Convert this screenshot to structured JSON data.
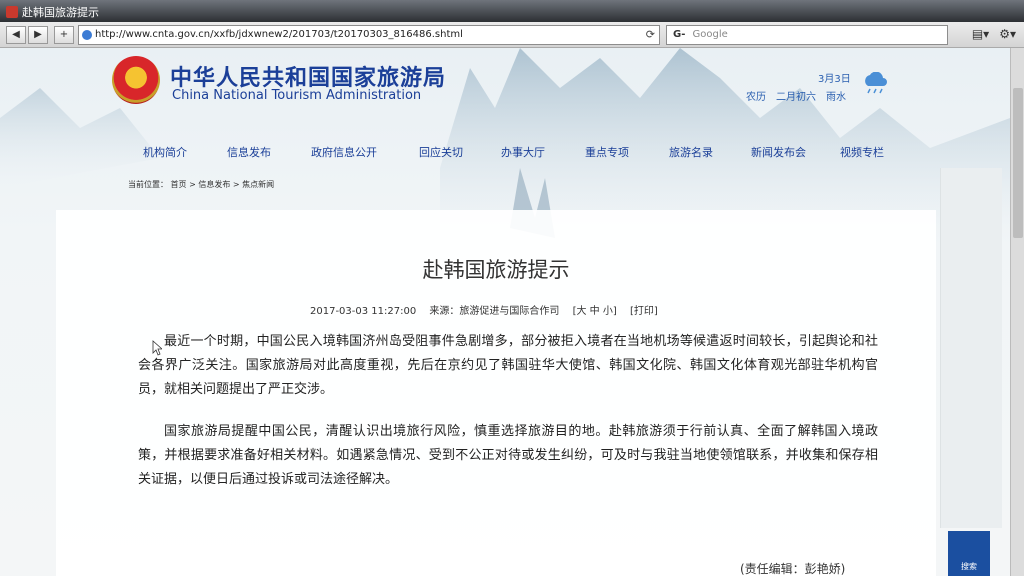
{
  "browser": {
    "window_title": "赴韩国旅游提示",
    "back": "◀",
    "forward": "▶",
    "add_tab": "+",
    "url": "http://www.cnta.gov.cn/xxfb/jdxwnew2/201703/t20170303_816486.shtml",
    "search_placeholder": "Google",
    "search_engine": "G-"
  },
  "header": {
    "site_name_cn": "中华人民共和国国家旅游局",
    "site_name_en": "China National Tourism Administration",
    "date": "3月3日",
    "lunar": "农历　二月初六　雨水"
  },
  "nav": {
    "items": [
      "机构简介",
      "信息发布",
      "政府信息公开",
      "回应关切",
      "办事大厅",
      "重点专项",
      "旅游名录",
      "新闻发布会",
      "视频专栏"
    ]
  },
  "breadcrumb": {
    "label": "当前位置：",
    "path": "首页 > 信息发布 > 焦点新闻"
  },
  "article": {
    "title": "赴韩国旅游提示",
    "datetime": "2017-03-03 11:27:00",
    "source": "来源：旅游促进与国际合作司",
    "font_size": "[大 中 小]",
    "print": "[打印]",
    "paragraph1": "最近一个时期，中国公民入境韩国济州岛受阻事件急剧增多，部分被拒入境者在当地机场等候遣返时间较长，引起舆论和社会各界广泛关注。国家旅游局对此高度重视，先后在京约见了韩国驻华大使馆、韩国文化院、韩国文化体育观光部驻华机构官员，就相关问题提出了严正交涉。",
    "paragraph2": "国家旅游局提醒中国公民，清醒认识出境旅行风险，慎重选择旅游目的地。赴韩旅游须于行前认真、全面了解韩国入境政策，并根据要求准备好相关材料。如遇紧急情况、受到不公正对待或发生纠纷，可及时与我驻当地使领馆联系，并收集和保存相关证据，以便日后通过投诉或司法途径解决。",
    "editor": "(责任编辑：彭艳娇)"
  },
  "side": {
    "search_label": "搜索"
  }
}
